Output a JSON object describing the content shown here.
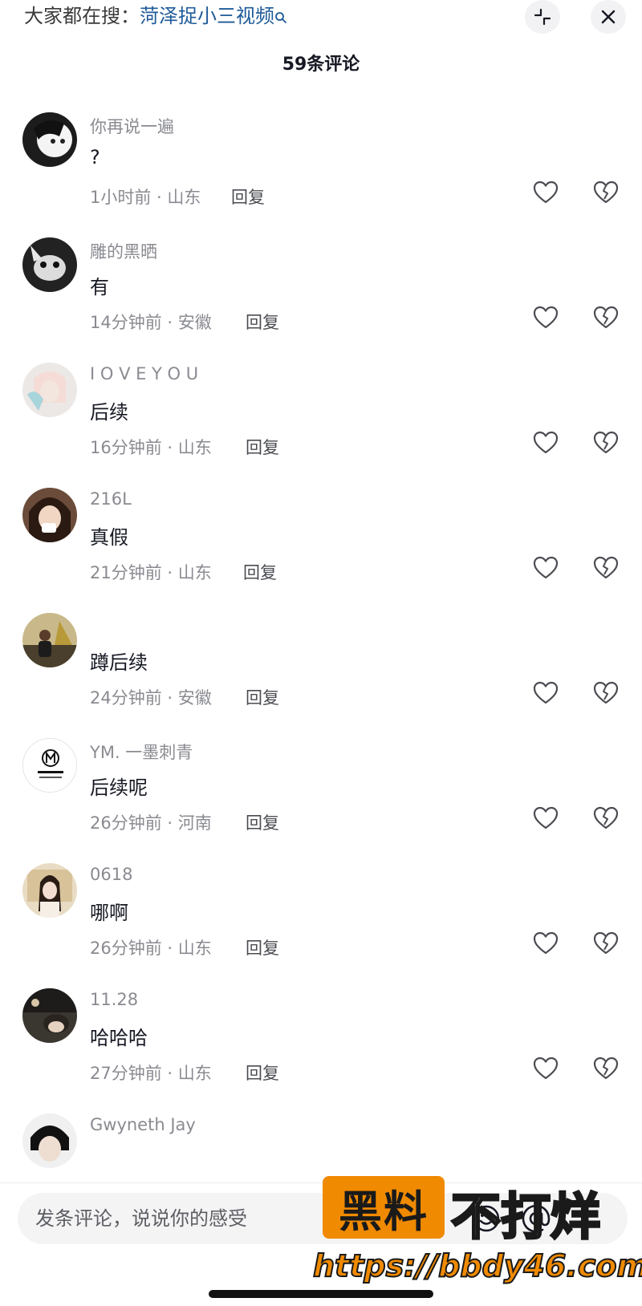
{
  "top": {
    "search_prefix": "大家都在搜：",
    "search_keyword": "菏泽捉小三视频",
    "collapse_icon": "collapse-icon",
    "close_icon": "close-icon"
  },
  "comment_count_title": "59条评论",
  "comments": [
    {
      "username": "你再说一遍",
      "text": "?",
      "time": "1小时前 · 山东",
      "reply": "回复"
    },
    {
      "username": "雕的黑晒",
      "text": "有",
      "time": "14分钟前 · 安徽",
      "reply": "回复"
    },
    {
      "username": "I O V E Y O U",
      "text": "后续",
      "time": "16分钟前 · 山东",
      "reply": "回复"
    },
    {
      "username": "216L",
      "text": "真假",
      "time": "21分钟前 · 山东",
      "reply": "回复"
    },
    {
      "username": "",
      "text": "蹲后续",
      "time": "24分钟前 · 安徽",
      "reply": "回复"
    },
    {
      "username": "YM. 一墨刺青",
      "text": "后续呢",
      "time": "26分钟前 · 河南",
      "reply": "回复"
    },
    {
      "username": "0618",
      "text": "哪啊",
      "time": "26分钟前 · 山东",
      "reply": "回复"
    },
    {
      "username": "11.28",
      "text": "哈哈哈",
      "time": "27分钟前 · 山东",
      "reply": "回复"
    },
    {
      "username": "Gwyneth Jay",
      "text": "",
      "time": "",
      "reply": ""
    }
  ],
  "input": {
    "placeholder": "发条评论，说说你的感受"
  },
  "watermark": {
    "box_text": "黑料",
    "text": "不打烊",
    "url": "https://bbdy46.com"
  },
  "colors": {
    "keyword": "#1e5a99",
    "watermark_orange": "#f08a00",
    "muted": "#8a8b91"
  }
}
